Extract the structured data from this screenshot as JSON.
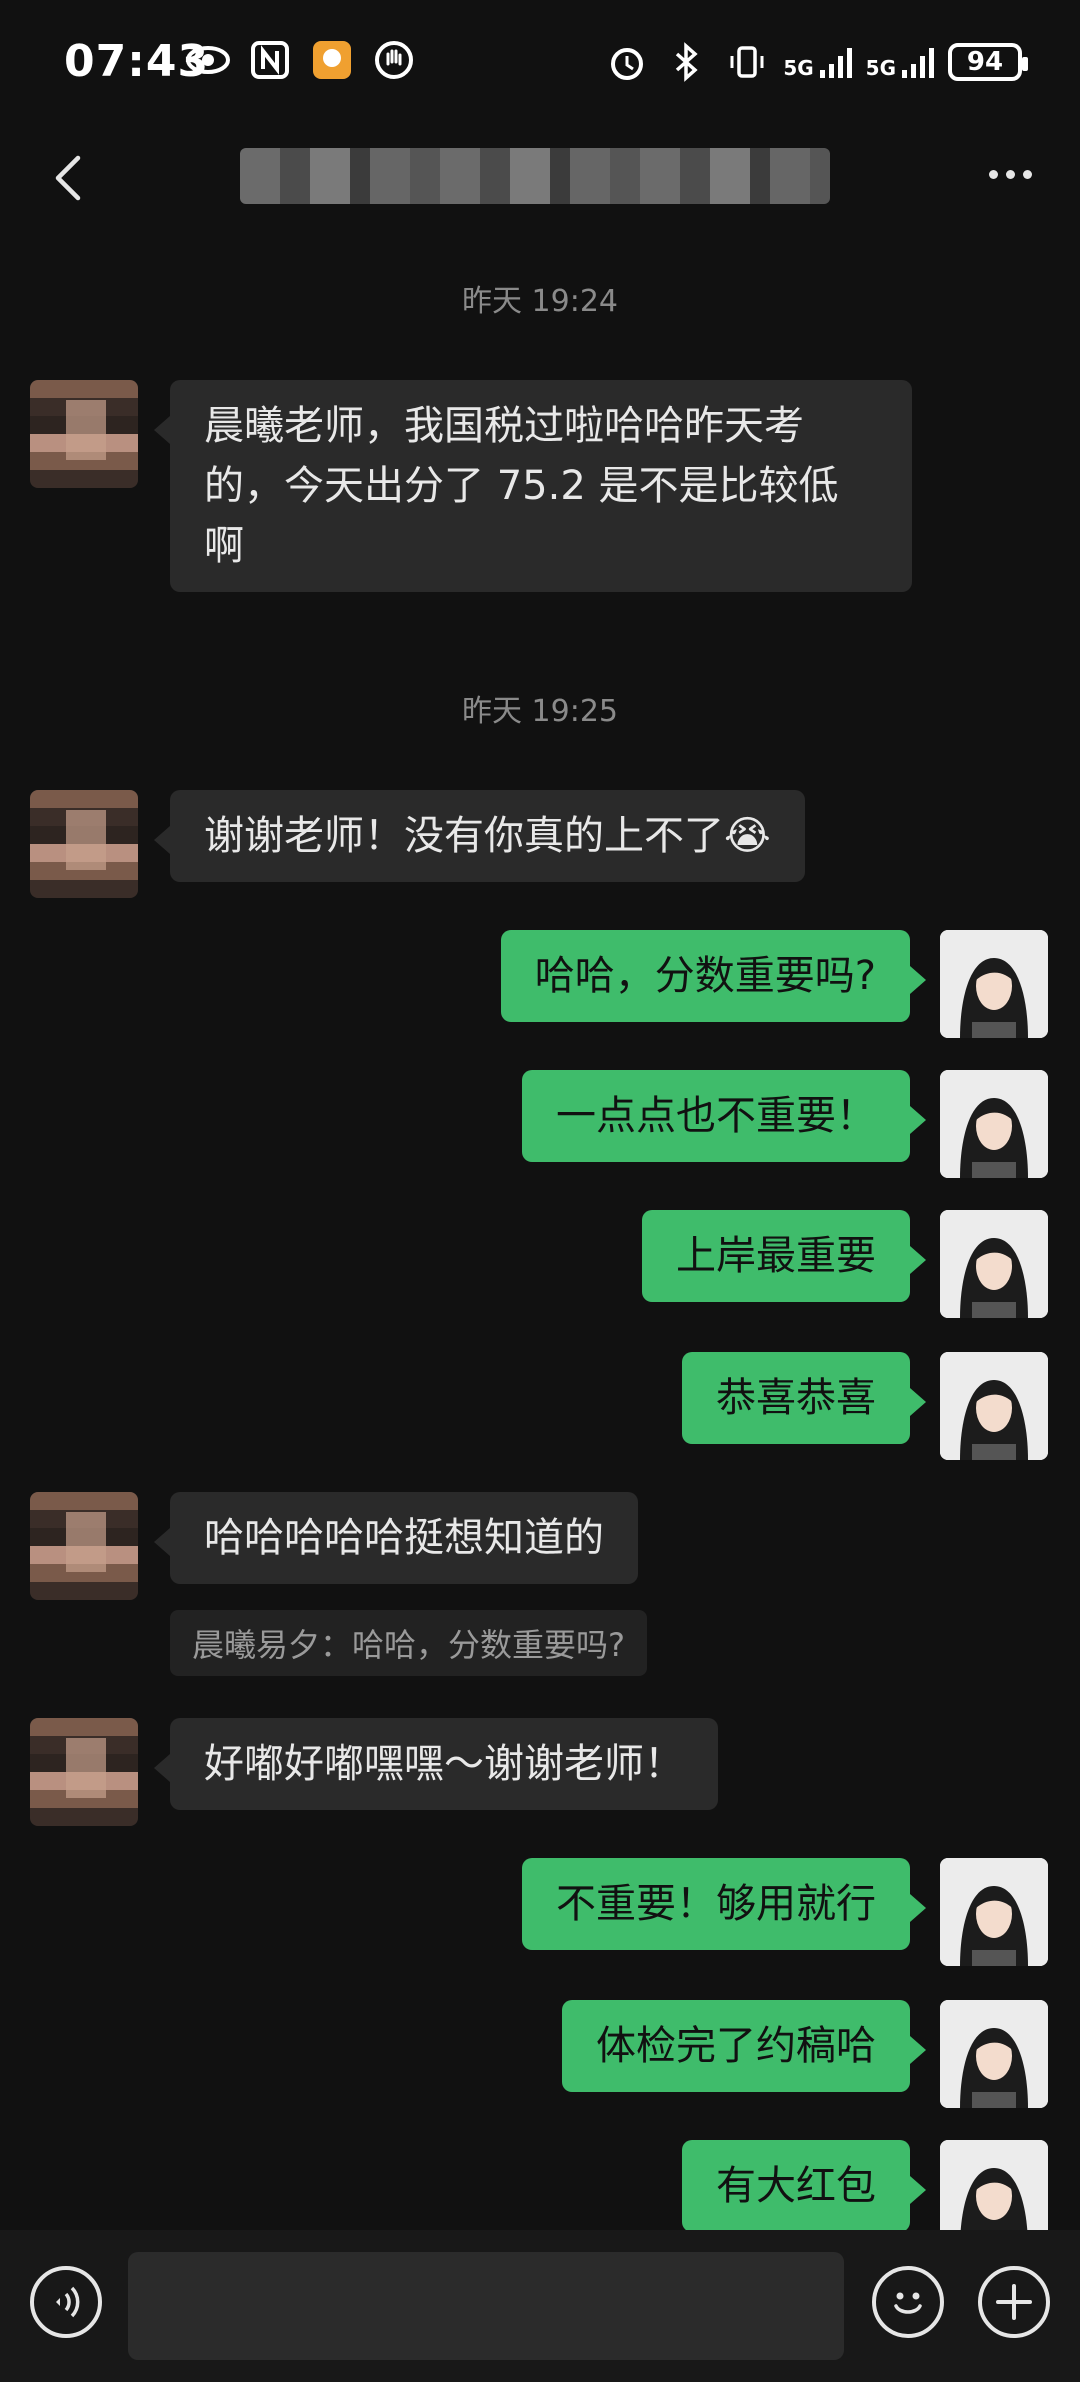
{
  "status_bar": {
    "time": "07:43",
    "signal_1": "5G",
    "signal_2": "5G",
    "battery": "94"
  },
  "header": {
    "title": "",
    "back_icon": "chevron-left-icon",
    "more_icon": "more-dots-icon"
  },
  "timestamps": [
    "昨天 19:24",
    "昨天 19:25"
  ],
  "messages": [
    {
      "side": "in",
      "text": "晨曦老师，我国税过啦哈哈昨天考的，今天出分了 75.2 是不是比较低啊"
    },
    {
      "side": "in",
      "text": "谢谢老师！没有你真的上不了😭"
    },
    {
      "side": "out",
      "text": "哈哈，分数重要吗?"
    },
    {
      "side": "out",
      "text": "一点点也不重要！"
    },
    {
      "side": "out",
      "text": "上岸最重要"
    },
    {
      "side": "out",
      "text": "恭喜恭喜"
    },
    {
      "side": "in",
      "text": "哈哈哈哈哈挺想知道的"
    },
    {
      "side": "quote",
      "text": "晨曦易夕：哈哈，分数重要吗?"
    },
    {
      "side": "in",
      "text": "好嘟好嘟嘿嘿～谢谢老师！"
    },
    {
      "side": "out",
      "text": "不重要！够用就行"
    },
    {
      "side": "out",
      "text": "体检完了约稿哈"
    },
    {
      "side": "out",
      "text": "有大红包"
    }
  ],
  "input_bar": {
    "placeholder": "",
    "voice_icon": "voice-icon",
    "emoji_icon": "emoji-icon",
    "plus_icon": "plus-icon"
  },
  "colors": {
    "background": "#111111",
    "bubble_in": "#2a2a2a",
    "bubble_out": "#3fbc6b"
  }
}
